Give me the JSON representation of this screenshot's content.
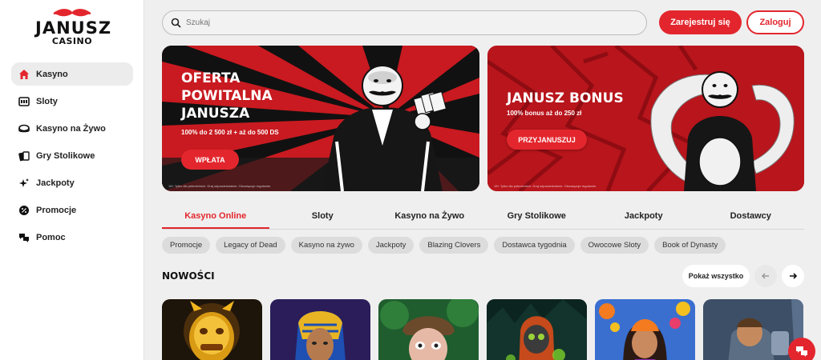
{
  "logo": {
    "brand": "JANUSZ",
    "sub": "CASINO"
  },
  "sidebar": {
    "items": [
      {
        "label": "Kasyno",
        "icon": "home-icon",
        "active": true
      },
      {
        "label": "Sloty",
        "icon": "slot-machine-icon"
      },
      {
        "label": "Kasyno na Żywo",
        "icon": "live-casino-icon"
      },
      {
        "label": "Gry Stolikowe",
        "icon": "cards-icon"
      },
      {
        "label": "Jackpoty",
        "icon": "sparkle-icon"
      },
      {
        "label": "Promocje",
        "icon": "percent-icon"
      },
      {
        "label": "Pomoc",
        "icon": "chat-bubbles-icon"
      }
    ]
  },
  "header": {
    "search_placeholder": "Szukaj",
    "register_label": "Zarejestruj się",
    "login_label": "Zaloguj"
  },
  "banners": [
    {
      "title": "OFERTA POWITALNA JANUSZA",
      "subtitle": "100% do 2 500 zł + aż do 500 DS",
      "button": "WPŁATA",
      "disclaimer": "18+ Tylko dla pełnoletnich. Graj odpowiedzialnie. Obowiązuje regulamin."
    },
    {
      "title": "JANUSZ BONUS",
      "subtitle": "100% bonus aż do 250 zł",
      "button": "PRZYJANUSZUJ",
      "disclaimer": "18+ Tylko dla pełnoletnich. Graj odpowiedzialnie. Obowiązuje regulamin."
    }
  ],
  "tabs": [
    "Kasyno Online",
    "Sloty",
    "Kasyno na Żywo",
    "Gry Stolikowe",
    "Jackpoty",
    "Dostawcy"
  ],
  "chips": [
    "Promocje",
    "Legacy of Dead",
    "Kasyno na żywo",
    "Jackpoty",
    "Blazing Clovers",
    "Dostawca tygodnia",
    "Owocowe Sloty",
    "Book of Dynasty"
  ],
  "section": {
    "title": "NOWOŚCI",
    "show_all": "Pokaż wszystko"
  },
  "colors": {
    "accent": "#e3262d",
    "background": "#efefef"
  }
}
